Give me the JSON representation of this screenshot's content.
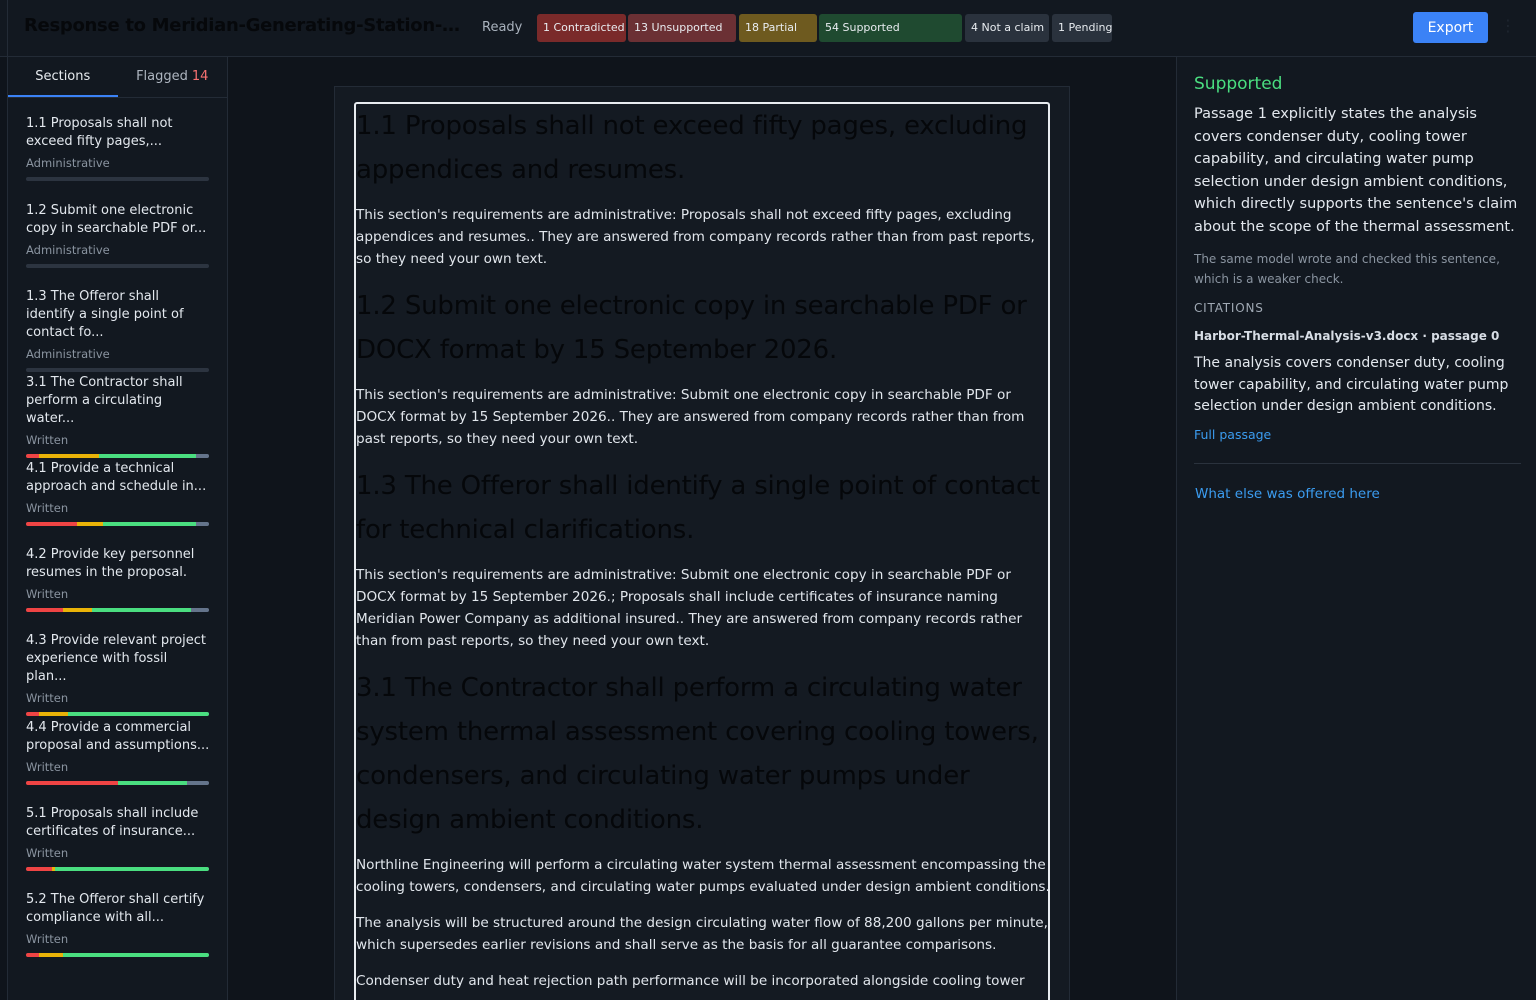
{
  "header": {
    "title": "Response to Meridian-Generating-Station-Cooling...",
    "status": "Ready",
    "chips": [
      {
        "label": "1 Contradicted",
        "color": "#7a2a2a"
      },
      {
        "label": "13 Unsupported",
        "color": "#6b3034"
      },
      {
        "label": "18 Partial",
        "color": "#6e5a1f"
      },
      {
        "label": "54 Supported",
        "color": "#1f4a30"
      },
      {
        "label": "4 Not a claim",
        "color": "#2a323d"
      },
      {
        "label": "1 Pending",
        "color": "#2a323d"
      }
    ],
    "export_label": "Export",
    "menu_icon": "kebab-icon"
  },
  "sidebar": {
    "tabs": [
      {
        "label": "Sections"
      },
      {
        "label": "Flagged",
        "count": "14"
      }
    ],
    "items": [
      {
        "title": "1.1 Proposals shall not exceed fifty pages,...",
        "category": "Administrative",
        "progress": []
      },
      {
        "title": "1.2 Submit one electronic copy in searchable PDF or...",
        "category": "Administrative",
        "progress": []
      },
      {
        "title": "1.3 The Offeror shall identify a single point of contact fo...",
        "category": "Administrative",
        "progress": []
      },
      {
        "title": "3.1 The Contractor shall perform a circulating water...",
        "category": "Written",
        "progress": [
          {
            "c": "#ef4444",
            "v": 7
          },
          {
            "c": "#eab308",
            "v": 33
          },
          {
            "c": "#4ade80",
            "v": 53
          },
          {
            "c": "#64748b",
            "v": 7
          }
        ]
      },
      {
        "title": "4.1 Provide a technical approach and schedule in...",
        "category": "Written",
        "progress": [
          {
            "c": "#ef4444",
            "v": 28
          },
          {
            "c": "#eab308",
            "v": 14
          },
          {
            "c": "#4ade80",
            "v": 51
          },
          {
            "c": "#64748b",
            "v": 7
          }
        ]
      },
      {
        "title": "4.2 Provide key personnel resumes in the proposal.",
        "category": "Written",
        "progress": [
          {
            "c": "#ef4444",
            "v": 20
          },
          {
            "c": "#eab308",
            "v": 16
          },
          {
            "c": "#4ade80",
            "v": 54
          },
          {
            "c": "#64748b",
            "v": 10
          }
        ]
      },
      {
        "title": "4.3 Provide relevant project experience with fossil plan...",
        "category": "Written",
        "progress": [
          {
            "c": "#ef4444",
            "v": 7
          },
          {
            "c": "#eab308",
            "v": 16
          },
          {
            "c": "#4ade80",
            "v": 77
          }
        ]
      },
      {
        "title": "4.4 Provide a commercial proposal and assumptions...",
        "category": "Written",
        "progress": [
          {
            "c": "#ef4444",
            "v": 50
          },
          {
            "c": "#4ade80",
            "v": 38
          },
          {
            "c": "#64748b",
            "v": 12
          }
        ]
      },
      {
        "title": "5.1 Proposals shall include certificates of insurance...",
        "category": "Written",
        "progress": [
          {
            "c": "#ef4444",
            "v": 14
          },
          {
            "c": "#eab308",
            "v": 2
          },
          {
            "c": "#4ade80",
            "v": 84
          }
        ]
      },
      {
        "title": "5.2 The Offeror shall certify compliance with all...",
        "category": "Written",
        "progress": [
          {
            "c": "#ef4444",
            "v": 7
          },
          {
            "c": "#eab308",
            "v": 13
          },
          {
            "c": "#4ade80",
            "v": 80
          }
        ]
      }
    ]
  },
  "document": {
    "blocks": [
      {
        "type": "h",
        "text": "1.1 Proposals shall not exceed fifty pages, excluding appendices and resumes."
      },
      {
        "type": "p",
        "text": "This section's requirements are administrative: Proposals shall not exceed fifty pages, excluding appendices and resumes.. They are answered from company records rather than from past reports, so they need your own text."
      },
      {
        "type": "h",
        "text": "1.2 Submit one electronic copy in searchable PDF or DOCX format by 15 September 2026."
      },
      {
        "type": "p",
        "text": "This section's requirements are administrative: Submit one electronic copy in searchable PDF or DOCX format by 15 September 2026.. They are answered from company records rather than from past reports, so they need your own text."
      },
      {
        "type": "h",
        "text": "1.3 The Offeror shall identify a single point of contact for technical clarifications."
      },
      {
        "type": "p",
        "text": "This section's requirements are administrative: Submit one electronic copy in searchable PDF or DOCX format by 15 September 2026.; Proposals shall include certificates of insurance naming Meridian Power Company as additional insured.. They are answered from company records rather than from past reports, so they need your own text."
      },
      {
        "type": "h",
        "text": "3.1 The Contractor shall perform a circulating water system thermal assessment covering cooling towers, condensers, and circulating water pumps under design ambient conditions."
      },
      {
        "type": "p",
        "text": "Northline Engineering will perform a circulating water system thermal assessment encompassing the cooling towers, condensers, and circulating water pumps evaluated under design ambient conditions."
      },
      {
        "type": "p",
        "text": "The analysis will be structured around the design circulating water flow of 88,200 gallons per minute, which supersedes earlier revisions and shall serve as the basis for all guarantee comparisons."
      },
      {
        "type": "p",
        "text": "Condenser duty and heat rejection path performance will be incorporated alongside cooling tower"
      }
    ]
  },
  "detail": {
    "verdict": "Supported",
    "explanation": "Passage 1 explicitly states the analysis covers condenser duty, cooling tower capability, and circulating water pump selection under design ambient conditions, which directly supports the sentence's claim about the scope of the thermal assessment.",
    "note": "The same model wrote and checked this sentence, which is a weaker check.",
    "citations_heading": "CITATIONS",
    "citation_source": "Harbor-Thermal-Analysis-v3.docx · passage 0",
    "citation_text": "The analysis covers condenser duty, cooling tower capability, and circulating water pump selection under design ambient conditions.",
    "full_passage_label": "Full passage",
    "other_offers_label": "What else was offered here"
  }
}
